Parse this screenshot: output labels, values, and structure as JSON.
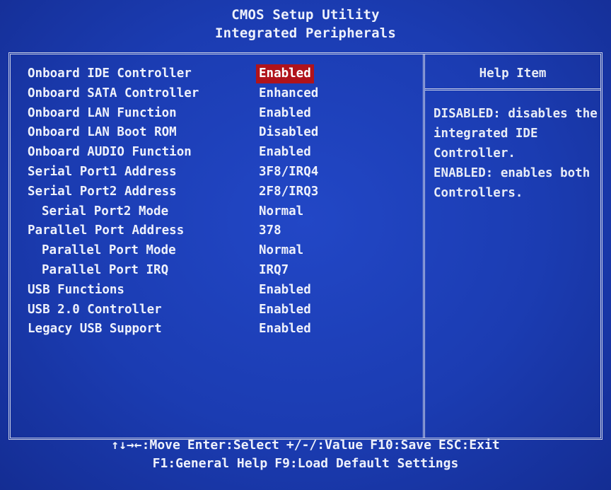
{
  "header": {
    "title": "CMOS Setup Utility",
    "subtitle": "Integrated Peripherals"
  },
  "settings": [
    {
      "label": "Onboard IDE Controller",
      "value": "Enabled",
      "selected": true,
      "indent": false
    },
    {
      "label": "Onboard SATA Controller",
      "value": "Enhanced",
      "selected": false,
      "indent": false
    },
    {
      "label": "Onboard LAN Function",
      "value": "Enabled",
      "selected": false,
      "indent": false
    },
    {
      "label": "Onboard LAN Boot ROM",
      "value": "Disabled",
      "selected": false,
      "indent": false
    },
    {
      "label": "Onboard AUDIO Function",
      "value": "Enabled",
      "selected": false,
      "indent": false
    },
    {
      "label": "Serial Port1 Address",
      "value": "3F8/IRQ4",
      "selected": false,
      "indent": false
    },
    {
      "label": "Serial Port2 Address",
      "value": "2F8/IRQ3",
      "selected": false,
      "indent": false
    },
    {
      "label": "Serial Port2 Mode",
      "value": "Normal",
      "selected": false,
      "indent": true
    },
    {
      "label": "Parallel Port Address",
      "value": "378",
      "selected": false,
      "indent": false
    },
    {
      "label": "Parallel Port Mode",
      "value": "Normal",
      "selected": false,
      "indent": true
    },
    {
      "label": "Parallel Port IRQ",
      "value": "IRQ7",
      "selected": false,
      "indent": true
    },
    {
      "label": "USB Functions",
      "value": "Enabled",
      "selected": false,
      "indent": false
    },
    {
      "label": "USB 2.0 Controller",
      "value": "Enabled",
      "selected": false,
      "indent": false
    },
    {
      "label": "Legacy USB Support",
      "value": "Enabled",
      "selected": false,
      "indent": false
    }
  ],
  "help": {
    "title": "Help Item",
    "lines": [
      "DISABLED: disables the",
      "integrated IDE",
      "Controller.",
      "ENABLED: enables both",
      "Controllers."
    ]
  },
  "footer": {
    "row1": [
      {
        "key": "↑↓→←",
        "action": ":Move"
      },
      {
        "key": "Enter",
        "action": ":Select"
      },
      {
        "key": "+/-/",
        "action": ":Value"
      },
      {
        "key": "F10",
        "action": ":Save"
      },
      {
        "key": "ESC",
        "action": ":Exit"
      }
    ],
    "row2": [
      {
        "key": "F1",
        "action": ":General Help"
      },
      {
        "key": "F9",
        "action": ":Load Default Settings"
      }
    ]
  },
  "colors": {
    "background": "#1d3fb6",
    "text": "#eef1fb",
    "highlight": "#b0131b",
    "border": "#c9cfe6"
  }
}
